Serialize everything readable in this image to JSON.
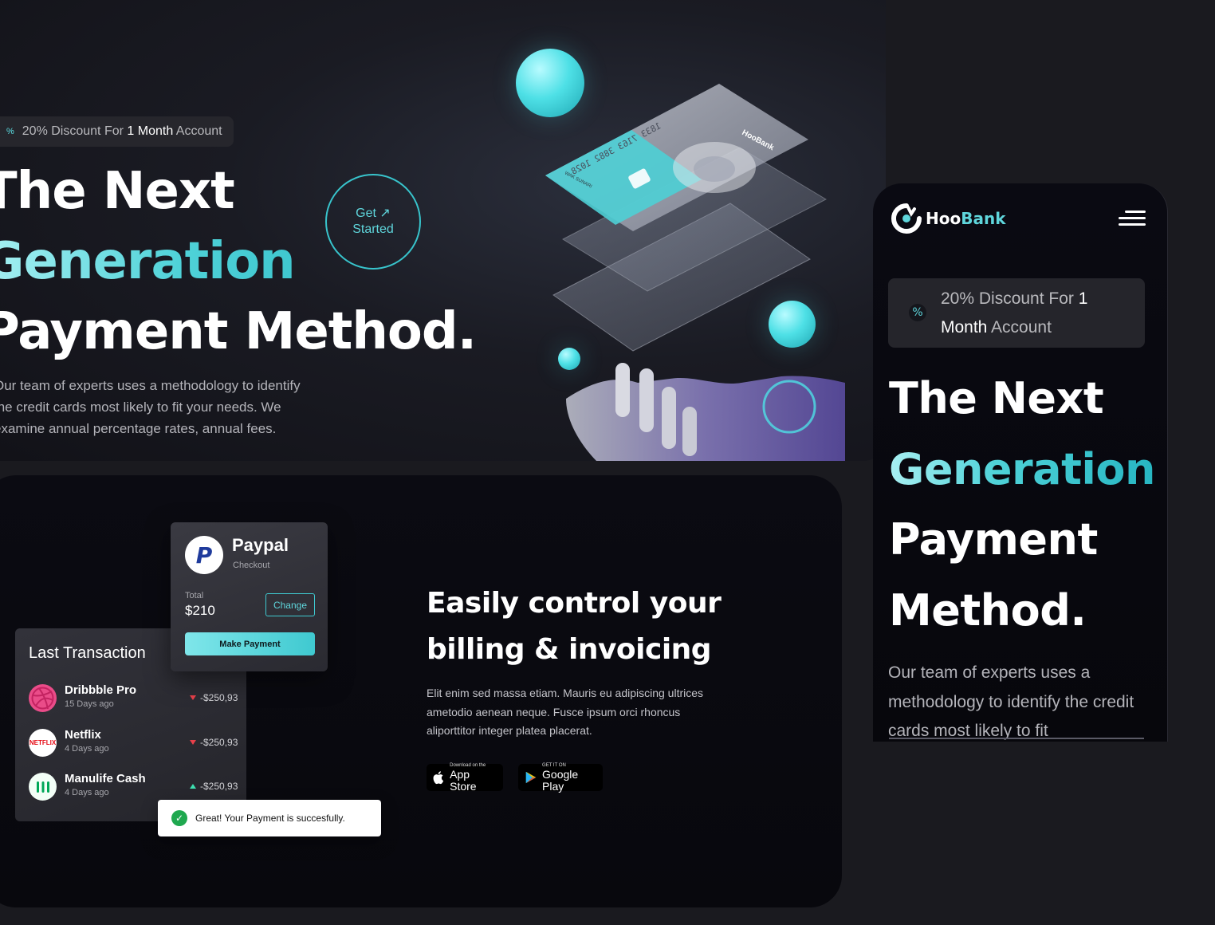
{
  "hero": {
    "discount": {
      "pct_icon": "%",
      "part1": "20% Discount For ",
      "bold1": "1",
      "part2": " Month",
      "part3": " Account"
    },
    "heading": {
      "line1": "The Next",
      "line2": "Generation",
      "line3": "Payment Method."
    },
    "paragraph": "Our team of experts uses a methodology to identify the credit cards most likely to fit your needs. We examine annual percentage rates, annual fees.",
    "cta": {
      "line1": "Get",
      "arrow": "↗",
      "line2": "Started"
    }
  },
  "card_art": {
    "number_text": "1833 7163 3882 1028",
    "brand_text": "HooBank",
    "holder_text": "WAK SUNARI"
  },
  "paypal": {
    "title": "Paypal",
    "subtitle": "Checkout",
    "total_label": "Total",
    "total_value": "$210",
    "change_label": "Change",
    "make_payment_label": "Make Payment"
  },
  "transactions": {
    "title": "Last Transaction",
    "items": [
      {
        "name": "Dribbble Pro",
        "date": "15 Days ago",
        "amount": "-$250,93",
        "trend": "down"
      },
      {
        "name": "Netflix",
        "date": "4 Days ago",
        "amount": "-$250,93",
        "trend": "down"
      },
      {
        "name": "Manulife Cash",
        "date": "4 Days ago",
        "amount": "-$250,93",
        "trend": "up"
      }
    ]
  },
  "toast": {
    "text": "Great! Your Payment is succesfully."
  },
  "billing": {
    "heading": "Easily control your billing & invoicing",
    "paragraph": "Elit enim sed massa etiam. Mauris eu adipiscing ultrices ametodio aenean neque. Fusce ipsum orci rhoncus aliporttitor integer platea placerat.",
    "app_store": {
      "small": "Download on the",
      "big": "App Store"
    },
    "google_play": {
      "small": "GET IT ON",
      "big": "Google Play"
    }
  },
  "mobile": {
    "logo_part1": "Hoo",
    "logo_part2": "Bank",
    "discount": {
      "pct_icon": "%",
      "part1": "20% Discount For ",
      "bold1": "1",
      "bold2": "Month",
      "part3": " Account"
    },
    "heading": {
      "line1": "The Next",
      "line2": "Generation",
      "line3": "Payment",
      "line4": "Method."
    },
    "paragraph": "Our team of experts uses a methodology to identify the credit cards most likely to fit"
  },
  "colors": {
    "accent": "#5fd6dc",
    "background": "#1a1a1f",
    "panel": "#0b0b12",
    "negative": "#e8404a",
    "positive": "#3ee0b0"
  }
}
